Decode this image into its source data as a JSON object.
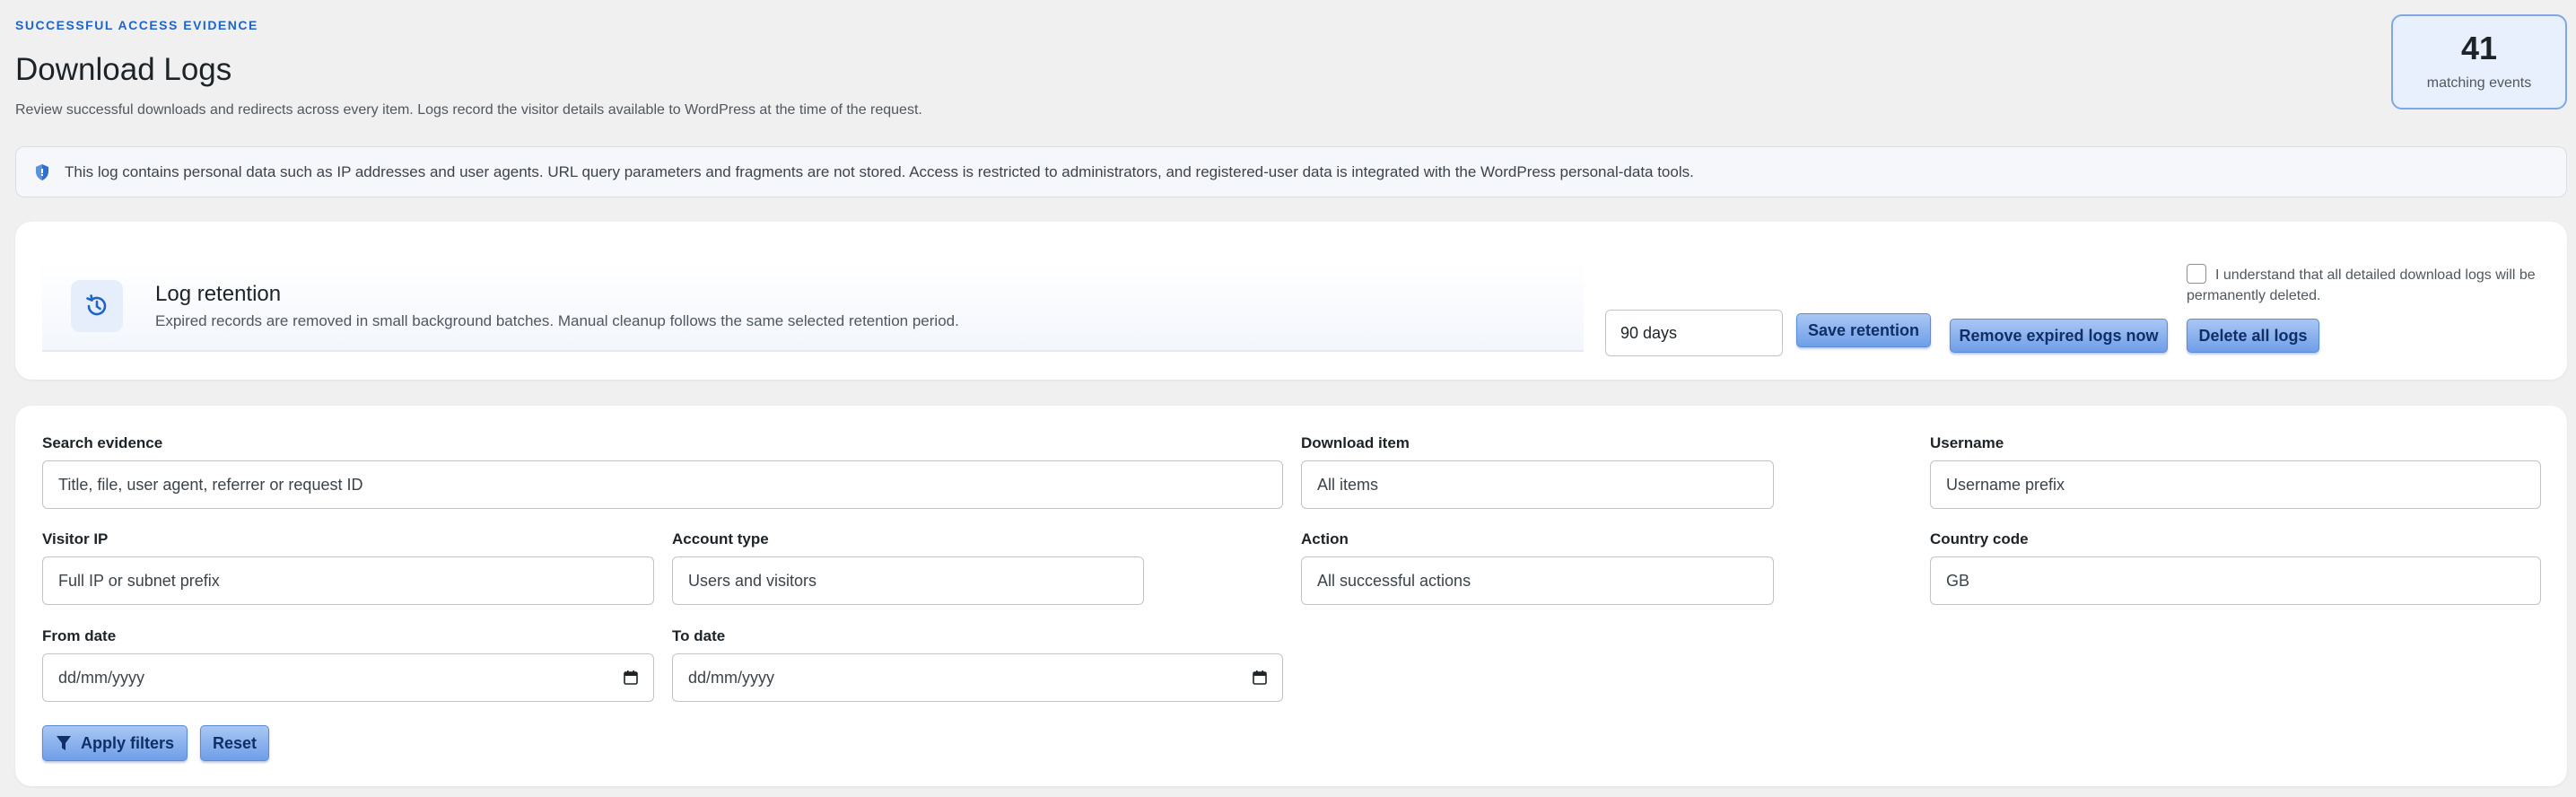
{
  "header": {
    "eyebrow": "SUCCESSFUL ACCESS EVIDENCE",
    "title": "Download Logs",
    "description": "Review successful downloads and redirects across every item. Logs record the visitor details available to WordPress at the time of the request."
  },
  "summary": {
    "count": "41",
    "count_label": "matching events"
  },
  "notice": {
    "icon": "shield-icon",
    "text": "This log contains personal data such as IP addresses and user agents. URL query parameters and fragments are not stored. Access is restricted to administrators, and registered-user data is integrated with the WordPress personal-data tools."
  },
  "retention": {
    "icon": "history-icon",
    "title": "Log retention",
    "description": "Expired records are removed in small background batches. Manual cleanup follows the same selected retention period.",
    "selected_period": "90 days",
    "save_label": "Save retention",
    "remove_label": "Remove expired logs now",
    "delete_label": "Delete all logs",
    "confirm_text": "I understand that all detailed download logs will be permanently deleted.",
    "confirm_checked": false
  },
  "filters": {
    "search": {
      "label": "Search evidence",
      "placeholder": "Title, file, user agent, referrer or request ID"
    },
    "download_item": {
      "label": "Download item",
      "value": "All items"
    },
    "username": {
      "label": "Username",
      "placeholder": "Username prefix"
    },
    "visitor_ip": {
      "label": "Visitor IP",
      "placeholder": "Full IP or subnet prefix"
    },
    "account_type": {
      "label": "Account type",
      "value": "Users and visitors"
    },
    "action": {
      "label": "Action",
      "value": "All successful actions"
    },
    "country_code": {
      "label": "Country code",
      "placeholder": "GB"
    },
    "from_date": {
      "label": "From date",
      "placeholder": "dd/mm/yyyy"
    },
    "to_date": {
      "label": "To date",
      "placeholder": "dd/mm/yyyy"
    },
    "apply_label": "Apply filters",
    "reset_label": "Reset"
  },
  "colors": {
    "accent": "#1f64c8",
    "button_top": "#a9c7f4",
    "button_bottom": "#6f9ee8",
    "background": "#f0f0f1"
  }
}
